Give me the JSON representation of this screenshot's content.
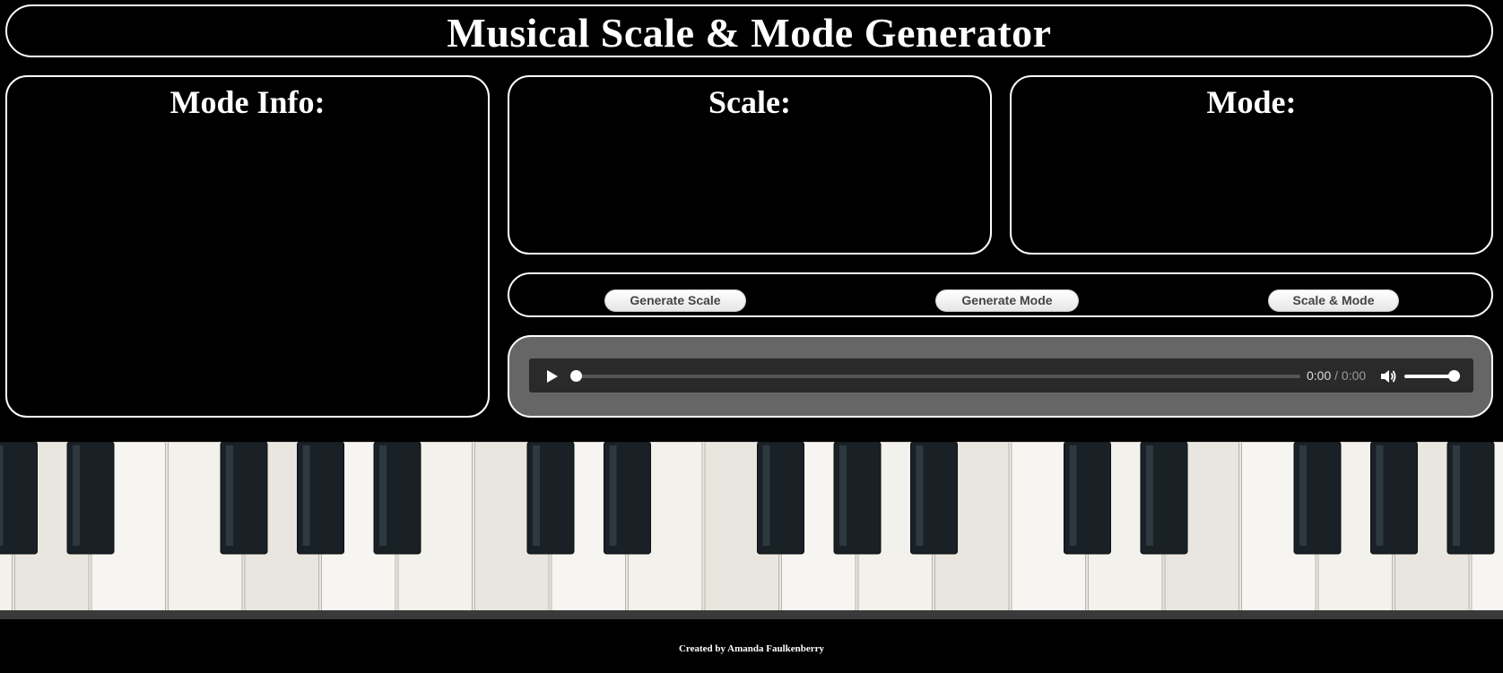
{
  "header": {
    "title": "Musical Scale & Mode Generator"
  },
  "panels": {
    "mode_info": {
      "heading": "Mode Info:"
    },
    "scale": {
      "heading": "Scale:"
    },
    "mode": {
      "heading": "Mode:"
    }
  },
  "buttons": {
    "generate_scale": "Generate Scale",
    "generate_mode": "Generate Mode",
    "scale_and_mode": "Scale & Mode"
  },
  "player": {
    "current_time": "0:00",
    "separator": " / ",
    "duration": "0:00",
    "progress": 0,
    "volume": 1.0,
    "icons": {
      "play": "play-icon",
      "volume": "volume-icon"
    }
  },
  "banner": {
    "image": "piano-keys-photo",
    "icon": "piano-keys-image"
  },
  "footer": {
    "credit": "Created by Amanda Faulkenberry"
  }
}
